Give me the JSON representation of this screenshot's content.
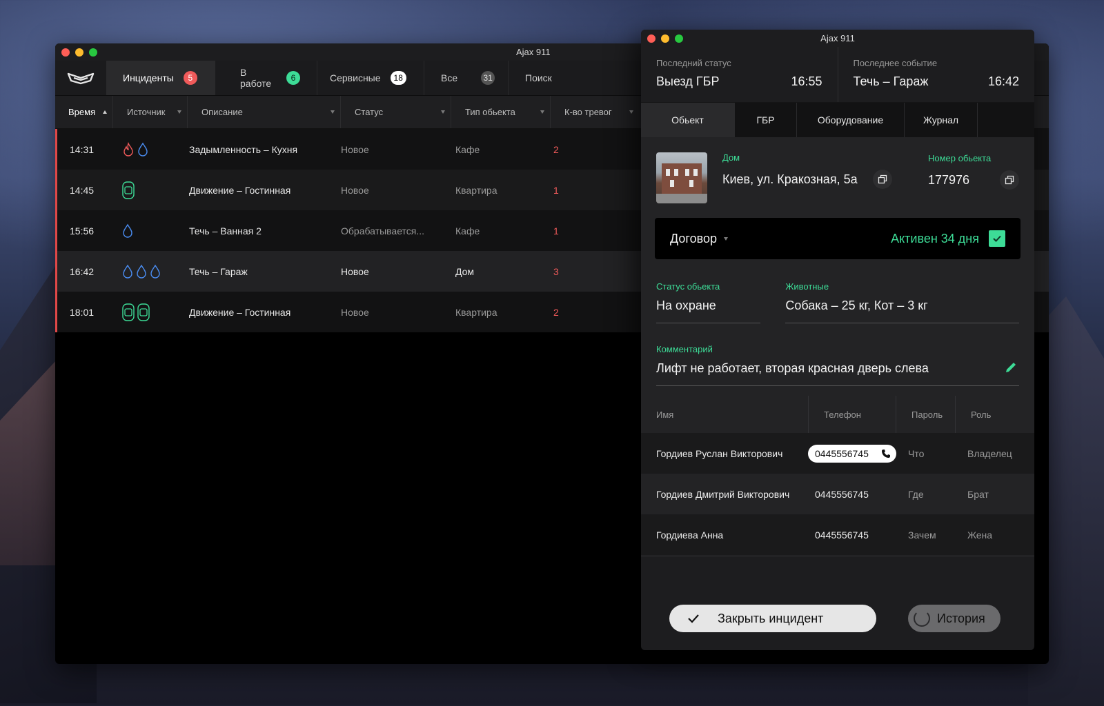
{
  "main_window": {
    "title": "Ajax 911",
    "tabs": [
      {
        "label": "Инциденты",
        "count": "5"
      },
      {
        "label": "В работе",
        "count": "6"
      },
      {
        "label": "Сервисные",
        "count": "18"
      },
      {
        "label": "Все",
        "count": "31"
      },
      {
        "label": "Поиск"
      }
    ],
    "columns": [
      "Время",
      "Источник",
      "Описание",
      "Статус",
      "Тип обьекта",
      "К-во тревог"
    ],
    "rows": [
      {
        "time": "14:31",
        "sources": [
          "fire-icon",
          "water-drop-icon"
        ],
        "description": "Задымленность – Кухня",
        "status": "Новое",
        "object_type": "Кафе",
        "alarms": "2"
      },
      {
        "time": "14:45",
        "sources": [
          "motion-sensor-icon"
        ],
        "description": "Движение – Гостинная",
        "status": "Новое",
        "object_type": "Квартира",
        "alarms": "1"
      },
      {
        "time": "15:56",
        "sources": [
          "water-drop-icon"
        ],
        "description": "Течь – Ванная 2",
        "status": "Обрабатывается...",
        "object_type": "Кафе",
        "alarms": "1"
      },
      {
        "time": "16:42",
        "sources": [
          "water-drop-icon",
          "water-drop-icon",
          "water-drop-icon"
        ],
        "description": "Течь – Гараж",
        "status": "Новое",
        "object_type": "Дом",
        "alarms": "3"
      },
      {
        "time": "18:01",
        "sources": [
          "motion-sensor-icon",
          "motion-sensor-icon"
        ],
        "description": "Движение – Гостинная",
        "status": "Новое",
        "object_type": "Квартира",
        "alarms": "2"
      }
    ]
  },
  "detail_window": {
    "title": "Ajax 911",
    "last_status": {
      "label": "Последний статус",
      "value": "Выезд ГБР",
      "time": "16:55"
    },
    "last_event": {
      "label": "Последнее событие",
      "value": "Течь – Гараж",
      "time": "16:42"
    },
    "tabs": [
      "Обьект",
      "ГБР",
      "Оборудование",
      "Журнал"
    ],
    "object": {
      "type_label": "Дом",
      "address": "Киев, ул. Кракозная, 5а",
      "number_label": "Номер обьекта",
      "number": "177976"
    },
    "contract": {
      "label": "Договор",
      "status": "Активен 34 дня"
    },
    "object_status": {
      "label": "Статус обьекта",
      "value": "На охране"
    },
    "animals": {
      "label": "Животные",
      "value": "Собака – 25 кг, Кот – 3 кг"
    },
    "comment": {
      "label": "Комментарий",
      "value": "Лифт не работает, вторая красная дверь слева"
    },
    "contacts_columns": [
      "Имя",
      "Телефон",
      "Пароль",
      "Роль"
    ],
    "contacts": [
      {
        "name": "Гордиев Руслан Викторович",
        "phone": "0445556745",
        "password": "Что",
        "role": "Владелец"
      },
      {
        "name": "Гордиев Дмитрий Викторович",
        "phone": "0445556745",
        "password": "Где",
        "role": "Брат"
      },
      {
        "name": "Гордиева Анна",
        "phone": "0445556745",
        "password": "Зачем",
        "role": "Жена"
      }
    ],
    "buttons": {
      "close_incident": "Закрыть инцидент",
      "history": "История"
    }
  },
  "colors": {
    "accent_green": "#3ddc97",
    "alert_red": "#f05a5a",
    "water_blue": "#4a8cf0"
  }
}
